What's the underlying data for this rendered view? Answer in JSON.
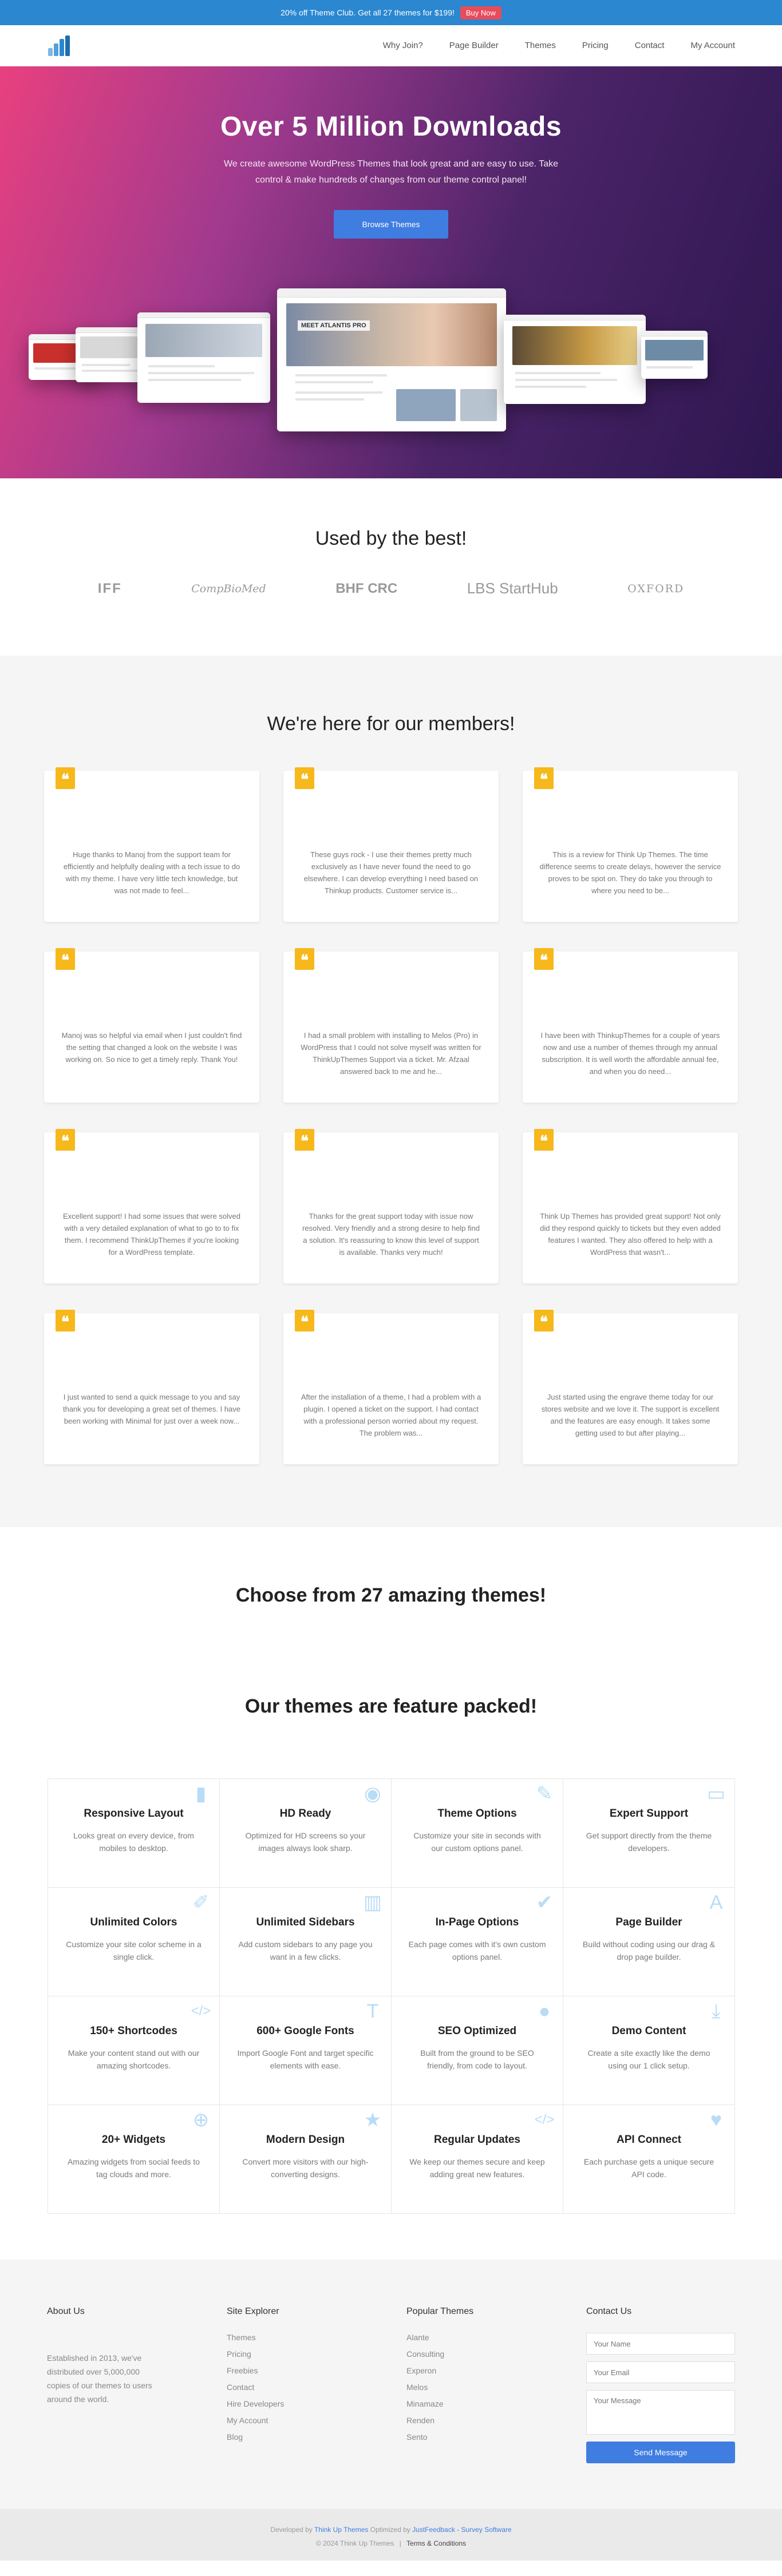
{
  "topbar": {
    "text": "20% off Theme Club. Get all 27 themes for $199!",
    "button": "Buy Now"
  },
  "nav": {
    "items": [
      "Why Join?",
      "Page Builder",
      "Themes",
      "Pricing",
      "Contact",
      "My Account"
    ]
  },
  "hero": {
    "title": "Over 5 Million Downloads",
    "text": "We create awesome WordPress Themes that look great and are easy to use. Take control & make hundreds of changes from our theme control panel!",
    "button": "Browse Themes",
    "mock_caption": "MEET ATLANTIS PRO"
  },
  "used": {
    "title": "Used by the best!",
    "logos": [
      "IFF",
      "CompBioMed",
      "BHF CRC",
      "LBS StartHub",
      "OXFORD"
    ]
  },
  "members": {
    "title": "We're here for our members!",
    "testimonials": [
      "Huge thanks to Manoj from the support team for efficiently and helpfully dealing with a tech issue to do with my theme. I have very little tech knowledge, but was not made to feel...",
      "These guys rock - I use their themes pretty much exclusively as I have never found the need to go elsewhere. I can develop everything I need based on Thinkup products. Customer service is...",
      "This is a review for Think Up Themes. The time difference seems to create delays, however the service proves to be spot on. They do take you through to where you need to be...",
      "Manoj was so helpful via email when I just couldn't find the setting that changed a look on the website I was working on. So nice to get a timely reply. Thank You!",
      "I had a small problem with installing to Melos (Pro) in WordPress that I could not solve myself was written for ThinkUpThemes Support via a ticket. Mr. Afzaal answered back to me and he...",
      "I have been with ThinkupThemes for a couple of years now and use a number of themes through my annual subscription. It is well worth the affordable annual fee, and when you do need...",
      "Excellent support! I had some issues that were solved with a very detailed explanation of what to go to to fix them. I recommend ThinkUpThemes if you're looking for a WordPress template.",
      "Thanks for the great support today with issue now resolved. Very friendly and a strong desire to help find a solution. It's reassuring to know this level of support is available. Thanks very much!",
      "Think Up Themes has provided great support! Not only did they respond quickly to tickets but they even added features I wanted. They also offered to help with a WordPress that wasn't...",
      "I just wanted to send a quick message to you and say thank you for developing a great set of themes. I have been working with Minimal for just over a week now...",
      "After the installation of a theme, I had a problem with a plugin. I opened a ticket on the support. I had contact with a professional person worried about my request. The problem was...",
      "Just started using the engrave theme today for our stores website and we love it. The support is excellent and the features are easy enough. It takes some getting used to but after playing..."
    ]
  },
  "choose": {
    "title": "Choose from 27 amazing themes!"
  },
  "features": {
    "title": "Our themes are feature packed!",
    "items": [
      {
        "title": "Responsive Layout",
        "text": "Looks great on every device, from mobiles to desktop.",
        "icon": "mobile-icon",
        "glyph": "▮"
      },
      {
        "title": "HD Ready",
        "text": "Optimized for HD screens so your images always look sharp.",
        "icon": "eye-icon",
        "glyph": "◉"
      },
      {
        "title": "Theme Options",
        "text": "Customize your site in seconds with our custom options panel.",
        "icon": "wrench-icon",
        "glyph": "✎"
      },
      {
        "title": "Expert Support",
        "text": "Get support directly from the theme developers.",
        "icon": "laptop-icon",
        "glyph": "▭"
      },
      {
        "title": "Unlimited Colors",
        "text": "Customize your site color scheme in a single click.",
        "icon": "paint-brush-icon",
        "glyph": "✐"
      },
      {
        "title": "Unlimited Sidebars",
        "text": "Add custom sidebars to any page you want in a few clicks.",
        "icon": "columns-icon",
        "glyph": "▥"
      },
      {
        "title": "In-Page Options",
        "text": "Each page comes with it's own custom options panel.",
        "icon": "check-icon",
        "glyph": "✔"
      },
      {
        "title": "Page Builder",
        "text": "Build without coding using our drag & drop page builder.",
        "icon": "font-icon",
        "glyph": "A"
      },
      {
        "title": "150+ Shortcodes",
        "text": "Make your content stand out with our amazing shortcodes.",
        "icon": "code-icon",
        "glyph": "</>"
      },
      {
        "title": "600+ Google Fonts",
        "text": "Import Google Font and target specific elements with ease.",
        "icon": "text-icon",
        "glyph": "T"
      },
      {
        "title": "SEO Optimized",
        "text": "Built from the ground to be SEO friendly, from code to layout.",
        "icon": "user-icon",
        "glyph": "●"
      },
      {
        "title": "Demo Content",
        "text": "Create a site exactly like the demo using our 1 click setup.",
        "icon": "download-icon",
        "glyph": "⤓"
      },
      {
        "title": "20+ Widgets",
        "text": "Amazing widgets from social feeds to tag clouds and more.",
        "icon": "globe-icon",
        "glyph": "⊕"
      },
      {
        "title": "Modern Design",
        "text": "Convert more visitors with our high-converting designs.",
        "icon": "star-icon",
        "glyph": "★"
      },
      {
        "title": "Regular Updates",
        "text": "We keep our themes secure and keep adding great new features.",
        "icon": "code-icon",
        "glyph": "</>"
      },
      {
        "title": "API Connect",
        "text": "Each purchase gets a unique secure API code.",
        "icon": "heart-icon",
        "glyph": "♥"
      }
    ]
  },
  "footer": {
    "about": {
      "title": "About Us",
      "text": "Established in 2013, we've distributed over 5,000,000 copies of our themes to users around the world."
    },
    "explorer": {
      "title": "Site Explorer",
      "links": [
        "Themes",
        "Pricing",
        "Freebies",
        "Contact",
        "Hire Developers",
        "My Account",
        "Blog"
      ]
    },
    "popular": {
      "title": "Popular Themes",
      "links": [
        "Alante",
        "Consulting",
        "Experon",
        "Melos",
        "Minamaze",
        "Renden",
        "Sento"
      ]
    },
    "contact": {
      "title": "Contact Us",
      "name_placeholder": "Your Name",
      "email_placeholder": "Your Email",
      "message_placeholder": "Your Message",
      "button": "Send Message"
    }
  },
  "bottom": {
    "developed_prefix": "Developed by",
    "developer": "Think Up Themes",
    "optimized_prefix": "Optimized by",
    "optimizer": "JustFeedback - Survey Software",
    "copyright": "© 2024 Think Up Themes",
    "terms": "Terms & Conditions"
  }
}
